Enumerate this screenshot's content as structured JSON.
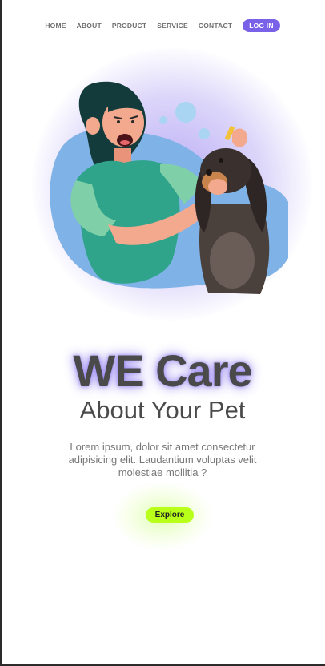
{
  "nav": {
    "items": [
      {
        "label": "HOME"
      },
      {
        "label": "ABOUT"
      },
      {
        "label": "PRODUCT"
      },
      {
        "label": "SERVICE"
      },
      {
        "label": "CONTACT"
      }
    ],
    "login_label": "LOG IN"
  },
  "hero": {
    "illustration": "woman-grooming-dog-illustration",
    "title": "WE Care",
    "subtitle": "About Your Pet",
    "description": "Lorem ipsum, dolor sit amet consectetur adipisicing elit. Laudantium voluptas velit molestiae mollitia ?",
    "cta_label": "Explore"
  },
  "colors": {
    "accent": "#7a62e8",
    "cta": "#b8ff1a",
    "text": "#4a4a4a"
  }
}
